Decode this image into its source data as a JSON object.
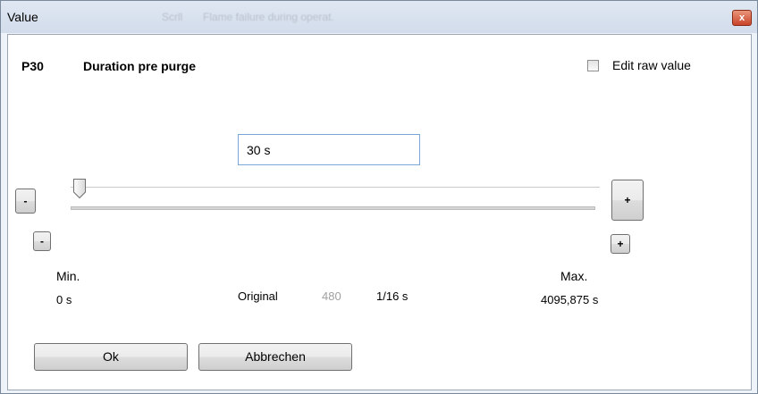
{
  "window": {
    "title": "Value",
    "background_hint_1": "Scrll",
    "background_hint_2": "Flame failure during operat."
  },
  "parameter": {
    "code": "P30",
    "name": "Duration pre purge",
    "edit_raw_label": "Edit raw value",
    "edit_raw_checked": false
  },
  "value_field": {
    "value": "30 s"
  },
  "slider": {
    "value": 30,
    "min": 0,
    "max": 4095.875
  },
  "buttons": {
    "decrease_large": "-",
    "decrease_small": "-",
    "increase_large": "+",
    "increase_small": "+",
    "ok": "Ok",
    "cancel": "Abbrechen",
    "close": "x"
  },
  "limits": {
    "min_label": "Min.",
    "min_value": "0 s",
    "max_label": "Max.",
    "max_value": "4095,875 s"
  },
  "original": {
    "label": "Original",
    "raw_value": "480",
    "resolution": "1/16 s"
  },
  "colors": {
    "raw_value_gray": "#a0a0a0",
    "input_border": "#7aa7d6",
    "close_button": "#c9442a"
  }
}
